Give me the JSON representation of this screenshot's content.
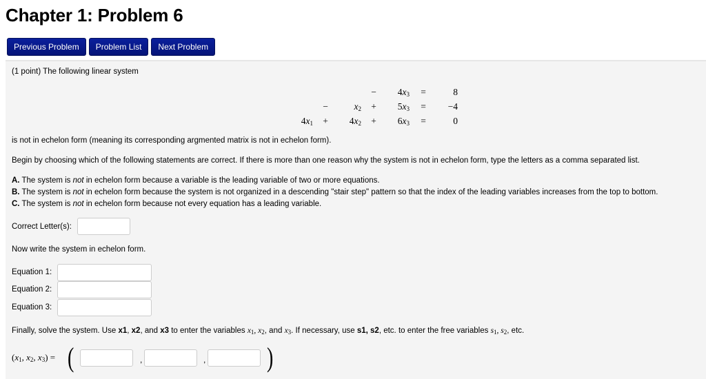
{
  "page_title": "Chapter 1: Problem 6",
  "nav": {
    "previous": "Previous Problem",
    "list": "Problem List",
    "next": "Next Problem"
  },
  "problem": {
    "intro": "(1 point) The following linear system",
    "system": [
      {
        "t1": "",
        "op1": "",
        "t2": "",
        "op2": "−",
        "t3": "4x3",
        "rhs": "8"
      },
      {
        "t1": "",
        "op1": "−",
        "t2": "x2",
        "op2": "+",
        "t3": "5x3",
        "rhs": "−4"
      },
      {
        "t1": "4x1",
        "op1": "+",
        "t2": "4x2",
        "op2": "+",
        "t3": "6x3",
        "rhs": "0"
      }
    ],
    "not_echelon": "is not in echelon form (meaning its corresponding argmented matrix is not in echelon form).",
    "instructions": "Begin by choosing which of the following statements are correct. If there is more than one reason why the system is not in echelon form, type the letters as a comma separated list.",
    "options": [
      {
        "letter": "A.",
        "pre": " The system is ",
        "em": "not",
        "post": " in echelon form because a variable is the leading variable of two or more equations."
      },
      {
        "letter": "B.",
        "pre": " The system is ",
        "em": "not",
        "post": " in echelon form because the system is not organized in a descending \"stair step\" pattern so that the index of the leading variables increases from the top to bottom."
      },
      {
        "letter": "C.",
        "pre": " The system is ",
        "em": "not",
        "post": " in echelon form because not every equation has a leading variable."
      }
    ],
    "correct_letters_label": "Correct Letter(s):",
    "correct_letters_value": "",
    "echelon_prompt": "Now write the system in echelon form.",
    "equations": [
      {
        "label": "Equation 1:",
        "value": ""
      },
      {
        "label": "Equation 2:",
        "value": ""
      },
      {
        "label": "Equation 3:",
        "value": ""
      }
    ],
    "solve": {
      "p1": "Finally, solve the system. Use ",
      "b1": "x1",
      "p2": ", ",
      "b2": "x2",
      "p3": ", and ",
      "b3": "x3",
      "p4": " to enter the variables ",
      "p5": ". If necessary, use ",
      "b4": "s1, s2",
      "p6": ", etc. to enter the free variables ",
      "p7": ", etc."
    },
    "tuple_label": "(x1, x2, x3) =",
    "answers": [
      "",
      "",
      ""
    ]
  }
}
